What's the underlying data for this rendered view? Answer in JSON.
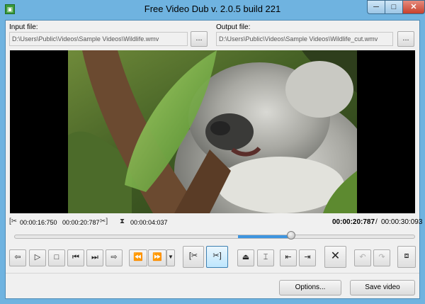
{
  "window": {
    "title": "Free Video Dub  v. 2.0.5 build 221",
    "app_icon": "film-dub-icon",
    "controls": {
      "minimize": "─",
      "maximize": "□",
      "close": "✕"
    }
  },
  "input": {
    "label": "Input file:",
    "path": "D:\\Users\\Public\\Videos\\Sample Videos\\Wildlife.wmv",
    "browse_label": "..."
  },
  "output": {
    "label": "Output file:",
    "path": "D:\\Users\\Public\\Videos\\Sample Videos\\Wildlife_cut.wmv",
    "browse_label": "..."
  },
  "selection": {
    "start": "00:00:16:750",
    "end": "00:00:20:787",
    "duration": "00:00:04:037",
    "start_icon": "selection-start-icon",
    "end_icon": "selection-end-icon",
    "duration_icon": "hourglass-icon"
  },
  "position": {
    "current": "00:00:20:787",
    "separator": "/",
    "total": "00:00:30:093",
    "progress": 0.69,
    "selection_start_fraction": 0.557,
    "selection_end_fraction": 0.69
  },
  "toolbar": {
    "icons": [
      "prev-frame-icon",
      "play-icon",
      "stop-icon",
      "prev-marker-icon",
      "next-marker-icon",
      "next-frame-icon",
      "jump-start-icon",
      "jump-end-icon",
      "dropdown-arrow-icon",
      "cut-start-icon",
      "cut-end-icon",
      "keyframe-icon",
      "split-icon",
      "go-selection-start-icon",
      "go-selection-end-icon",
      "delete-selection-icon",
      "undo-icon",
      "redo-icon",
      "fullscreen-icon"
    ]
  },
  "buttons": {
    "options": "Options...",
    "save": "Save video"
  },
  "colors": {
    "titlebar": "#6fb3e0",
    "selection": "#3d95e0",
    "close": "#c7412c"
  }
}
